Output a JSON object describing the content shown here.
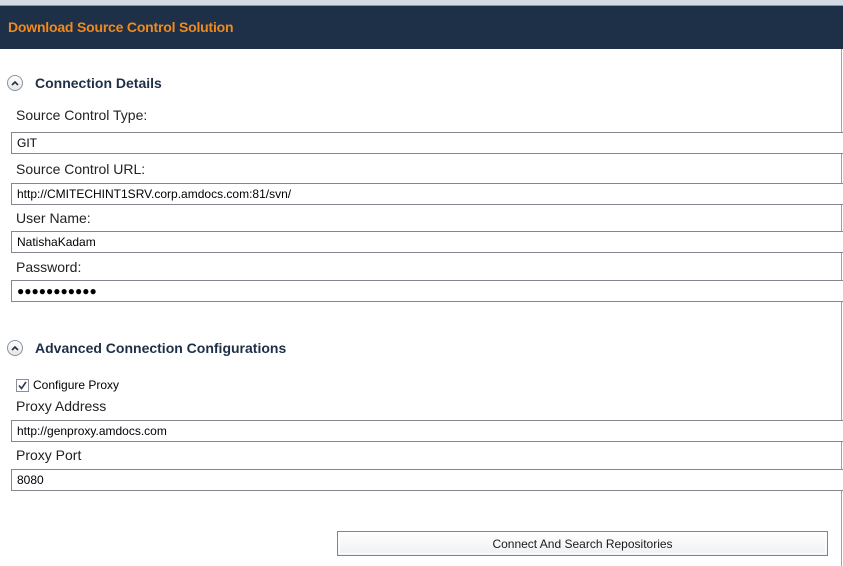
{
  "window": {
    "title": "Download Source Control Solution"
  },
  "connection_details": {
    "title": "Connection Details",
    "collapse_icon": "chevron-up-icon",
    "source_control_type": {
      "label": "Source Control Type:",
      "value": "GIT"
    },
    "source_control_url": {
      "label": "Source Control URL:",
      "value": "http://CMITECHINT1SRV.corp.amdocs.com:81/svn/"
    },
    "user_name": {
      "label": "User Name:",
      "value": "NatishaKadam"
    },
    "password": {
      "label": "Password:",
      "value": "●●●●●●●●●●●"
    }
  },
  "advanced": {
    "title": "Advanced Connection Configurations",
    "collapse_icon": "chevron-up-icon",
    "configure_proxy": {
      "label": "Configure Proxy",
      "checked": true
    },
    "proxy_address": {
      "label": "Proxy Address",
      "value": "http://genproxy.amdocs.com"
    },
    "proxy_port": {
      "label": "Proxy Port",
      "value": "8080"
    }
  },
  "actions": {
    "connect_label": "Connect And Search Repositories"
  },
  "colors": {
    "header_bg": "#1e2f48",
    "header_text": "#f08a1c",
    "section_title": "#1e2f48"
  }
}
